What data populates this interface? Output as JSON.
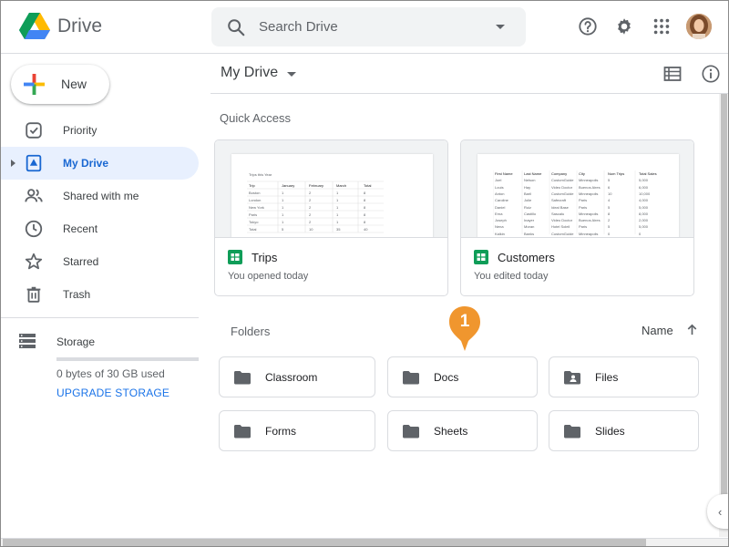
{
  "header": {
    "logo_text": "Drive",
    "search_placeholder": "Search Drive",
    "icons": [
      "drive-logo-icon",
      "search-icon",
      "chevron-down-icon",
      "help-icon",
      "gear-icon",
      "apps-grid-icon",
      "avatar"
    ]
  },
  "sidebar": {
    "new_label": "New",
    "items": [
      {
        "label": "Priority",
        "icon": "priority-icon"
      },
      {
        "label": "My Drive",
        "icon": "my-drive-icon",
        "active": true
      },
      {
        "label": "Shared with me",
        "icon": "shared-icon"
      },
      {
        "label": "Recent",
        "icon": "clock-icon"
      },
      {
        "label": "Starred",
        "icon": "star-icon"
      },
      {
        "label": "Trash",
        "icon": "trash-icon"
      }
    ],
    "storage": {
      "label": "Storage",
      "used_text": "0 bytes of 30 GB used",
      "used_fraction": 0,
      "upgrade_label": "UPGRADE STORAGE"
    }
  },
  "main": {
    "breadcrumb": "My Drive",
    "quick_access_title": "Quick Access",
    "quick_access": [
      {
        "title": "Trips",
        "subtitle": "You opened today"
      },
      {
        "title": "Customers",
        "subtitle": "You edited today"
      }
    ],
    "folders_title": "Folders",
    "sort_label": "Name",
    "folders": [
      {
        "label": "Classroom",
        "icon": "folder-icon"
      },
      {
        "label": "Docs",
        "icon": "folder-icon"
      },
      {
        "label": "Files",
        "icon": "shared-folder-icon"
      },
      {
        "label": "Forms",
        "icon": "folder-icon"
      },
      {
        "label": "Sheets",
        "icon": "folder-icon"
      },
      {
        "label": "Slides",
        "icon": "folder-icon"
      }
    ]
  },
  "trips_preview": {
    "title": "Trips this Year",
    "headers": [
      "Trip",
      "January",
      "February",
      "March",
      "Total"
    ],
    "rows": [
      [
        "Boston",
        "1",
        "2",
        "1",
        "8"
      ],
      [
        "London",
        "1",
        "2",
        "1",
        "8"
      ],
      [
        "New York",
        "1",
        "2",
        "1",
        "8"
      ],
      [
        "Paris",
        "1",
        "2",
        "1",
        "8"
      ],
      [
        "Tokyo",
        "1",
        "2",
        "1",
        "8"
      ],
      [
        "Total",
        "5",
        "10",
        "35",
        "40"
      ]
    ]
  },
  "customers_preview": {
    "headers": [
      "First Name",
      "Last Name",
      "Company",
      "City",
      "Num Trips",
      "Total Sales"
    ],
    "rows": [
      [
        "Joel",
        "Nelson",
        "CustomGuide",
        "Minneapolis",
        "5",
        "5,000"
      ],
      [
        "Louis",
        "Hay",
        "Video Doctor",
        "Buenos Aires",
        "6",
        "6,000"
      ],
      [
        "Anton",
        "Baril",
        "CustomGuide",
        "Minneapolis",
        "10",
        "10,000"
      ],
      [
        "Caroline",
        "Jolie",
        "Safecraft",
        "Paris",
        "4",
        "4,000"
      ],
      [
        "Daniel",
        "Ruiz",
        "Ideal Base",
        "Paris",
        "5",
        "5,000"
      ],
      [
        "Erna",
        "Castillo",
        "Sascalu",
        "Minneapolis",
        "8",
        "8,000"
      ],
      [
        "Joseph",
        "Inayer",
        "Video Doctor",
        "Buenos Aires",
        "2",
        "2,000"
      ],
      [
        "Nena",
        "Moran",
        "Hotel Soleil",
        "Paris",
        "5",
        "5,000"
      ],
      [
        "Kalkin",
        "Banks",
        "CustomGuide",
        "Minneapolis",
        "0",
        "0"
      ]
    ]
  },
  "callout": {
    "number": "1",
    "color": "#f0962e"
  },
  "colors": {
    "accent": "#1a73e8",
    "active_bg": "#e8f0fe",
    "sheets_green": "#0f9d58"
  }
}
